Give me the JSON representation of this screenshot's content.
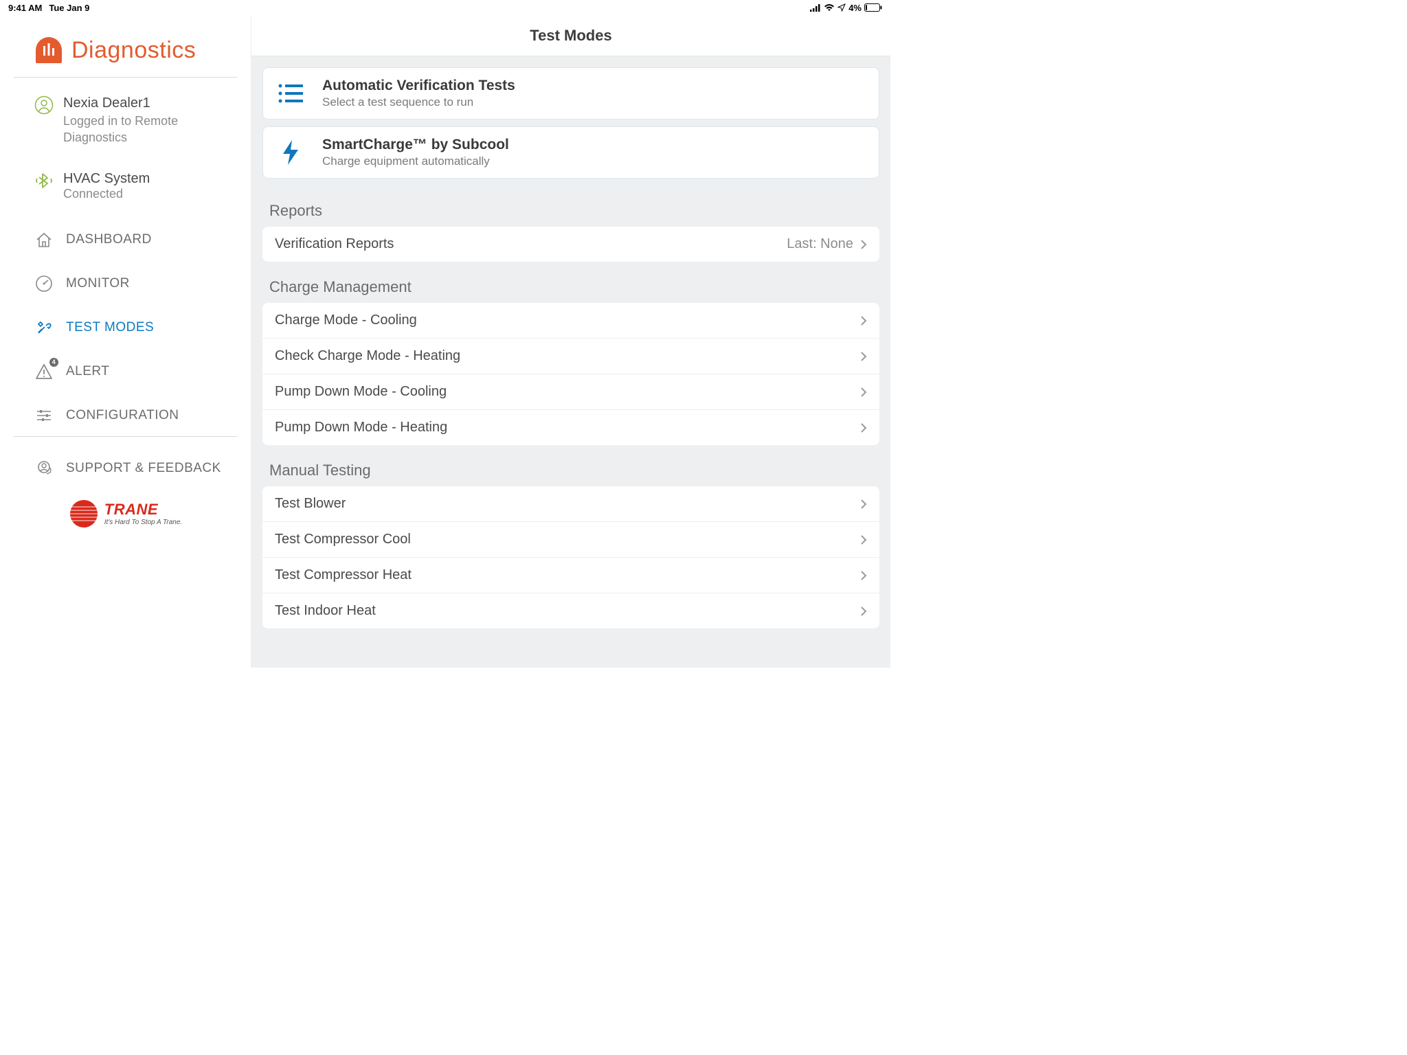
{
  "statusBar": {
    "time": "9:41 AM",
    "date": "Tue Jan 9",
    "battery": "4%"
  },
  "sidebar": {
    "appTitle": "Diagnostics",
    "user": {
      "name": "Nexia Dealer1",
      "sub": "Logged in to Remote Diagnostics"
    },
    "hvac": {
      "name": "HVAC System",
      "sub": "Connected"
    },
    "nav": {
      "dashboard": "DASHBOARD",
      "monitor": "MONITOR",
      "testmodes": "TEST MODES",
      "alert": "ALERT",
      "alertBadge": "4",
      "configuration": "CONFIGURATION",
      "support": "SUPPORT & FEEDBACK"
    },
    "brand": {
      "name": "TRANE",
      "tagline": "It's Hard To Stop A Trane."
    }
  },
  "main": {
    "title": "Test Modes",
    "cards": [
      {
        "title": "Automatic Verification Tests",
        "sub": "Select a test sequence to run"
      },
      {
        "title": "SmartCharge™ by Subcool",
        "sub": "Charge equipment automatically"
      }
    ],
    "sections": [
      {
        "title": "Reports",
        "items": [
          {
            "label": "Verification Reports",
            "secondary": "Last: None"
          }
        ]
      },
      {
        "title": "Charge Management",
        "items": [
          {
            "label": "Charge Mode - Cooling"
          },
          {
            "label": "Check Charge Mode - Heating"
          },
          {
            "label": "Pump Down Mode - Cooling"
          },
          {
            "label": "Pump Down Mode - Heating"
          }
        ]
      },
      {
        "title": "Manual Testing",
        "items": [
          {
            "label": "Test Blower"
          },
          {
            "label": "Test Compressor Cool"
          },
          {
            "label": "Test Compressor Heat"
          },
          {
            "label": "Test Indoor Heat"
          }
        ]
      }
    ]
  }
}
